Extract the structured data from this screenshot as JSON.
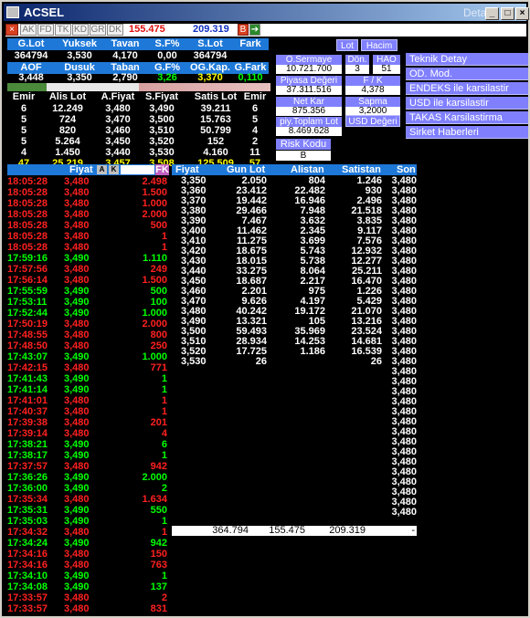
{
  "window": {
    "title": "ACSEL",
    "title_right": "Detay"
  },
  "toolbar": {
    "tabs": [
      "AK",
      "FD",
      "TK",
      "KD",
      "GR",
      "DK"
    ],
    "vol1": "155.475",
    "vol2": "209.319",
    "b_label": "B"
  },
  "summary": {
    "h1": [
      "G.Lot",
      "Yuksek",
      "Tavan",
      "S.F%",
      "S.Lot",
      "Fark"
    ],
    "r1": [
      "364794",
      "3,530",
      "4,170",
      "0,00",
      "364794",
      ""
    ],
    "h2": [
      "AOF",
      "Dusuk",
      "Taban",
      "G.F%",
      "OG.Kap.",
      "G.Fark"
    ],
    "r2": [
      "3,448",
      "3,350",
      "2,790",
      "3,26",
      "3,370",
      "0,110"
    ]
  },
  "depth": {
    "headers": [
      "Emir",
      "Alis Lot",
      "A.Fiyat",
      "S.Fiyat",
      "Satis Lot",
      "Emir"
    ],
    "rows": [
      [
        "6",
        "12.249",
        "3,480",
        "3,490",
        "39.211",
        "6"
      ],
      [
        "5",
        "724",
        "3,470",
        "3,500",
        "15.763",
        "5"
      ],
      [
        "5",
        "820",
        "3,460",
        "3,510",
        "50.799",
        "4"
      ],
      [
        "5",
        "5.264",
        "3,450",
        "3,520",
        "152",
        "2"
      ],
      [
        "4",
        "1.450",
        "3,440",
        "3,530",
        "4.160",
        "11"
      ]
    ],
    "total": [
      "47",
      "25.219",
      "3,457",
      "3,508",
      "125.509",
      "57"
    ]
  },
  "panel": {
    "lot_btn": "Lot",
    "hacim_btn": "Hacim",
    "o_sermaye_label": "O.Sermaye",
    "o_sermaye": "10.721.700",
    "don_label": "Dön.",
    "don": "3",
    "hao_label": "HAO",
    "hao": "51",
    "piyasa_label": "Piyasa Değeri",
    "piyasa": "37.311.516",
    "fk_label": "F / K",
    "fk": "4,378",
    "netkar_label": "Net Kar",
    "netkar": "875.356",
    "sapma_label": "Sapma",
    "sapma": "3,2000",
    "toplam_label": "piy.Toplam Lot",
    "toplam": "8.469.628",
    "usd_btn": "USD Değeri",
    "risk_label": "Risk Kodu",
    "risk": "B"
  },
  "side_menu": [
    "Teknik Detay",
    "OD. Mod.",
    "ENDEKS ile karsilastir",
    "USD ile karsilastir",
    "TAKAS Karsilastirma",
    "Sirket Haberleri"
  ],
  "trades": {
    "header": [
      "Fiyat",
      "A",
      "K",
      "FK"
    ],
    "rows": [
      [
        "18:05:28",
        "3,480",
        "2.498",
        "r"
      ],
      [
        "18:05:28",
        "3,480",
        "1.500",
        "r"
      ],
      [
        "18:05:28",
        "3,480",
        "1.000",
        "r"
      ],
      [
        "18:05:28",
        "3,480",
        "2.000",
        "r"
      ],
      [
        "18:05:28",
        "3,480",
        "500",
        "r"
      ],
      [
        "18:05:28",
        "3,480",
        "1",
        "r"
      ],
      [
        "18:05:28",
        "3,480",
        "1",
        "r"
      ],
      [
        "17:59:16",
        "3,490",
        "1.110",
        "g"
      ],
      [
        "17:57:56",
        "3,480",
        "249",
        "r"
      ],
      [
        "17:56:14",
        "3,480",
        "1.500",
        "r"
      ],
      [
        "17:55:59",
        "3,490",
        "500",
        "g"
      ],
      [
        "17:53:11",
        "3,490",
        "100",
        "g"
      ],
      [
        "17:52:44",
        "3,490",
        "1.000",
        "g"
      ],
      [
        "17:50:19",
        "3,480",
        "2.000",
        "r"
      ],
      [
        "17:48:55",
        "3,480",
        "800",
        "r"
      ],
      [
        "17:48:50",
        "3,480",
        "250",
        "r"
      ],
      [
        "17:43:07",
        "3,490",
        "1.000",
        "g"
      ],
      [
        "17:42:15",
        "3,480",
        "771",
        "r"
      ],
      [
        "17:41:43",
        "3,490",
        "1",
        "g"
      ],
      [
        "17:41:14",
        "3,490",
        "1",
        "g"
      ],
      [
        "17:41:01",
        "3,480",
        "1",
        "r"
      ],
      [
        "17:40:37",
        "3,480",
        "1",
        "r"
      ],
      [
        "17:39:38",
        "3,480",
        "201",
        "r"
      ],
      [
        "17:39:14",
        "3,480",
        "4",
        "r"
      ],
      [
        "17:38:21",
        "3,490",
        "6",
        "g"
      ],
      [
        "17:38:17",
        "3,490",
        "1",
        "g"
      ],
      [
        "17:37:57",
        "3,480",
        "942",
        "r"
      ],
      [
        "17:36:26",
        "3,490",
        "2.000",
        "g"
      ],
      [
        "17:36:00",
        "3,490",
        "2",
        "g"
      ],
      [
        "17:35:34",
        "3,480",
        "1.634",
        "r"
      ],
      [
        "17:35:31",
        "3,490",
        "550",
        "g"
      ],
      [
        "17:35:03",
        "3,490",
        "1",
        "g"
      ],
      [
        "17:34:32",
        "3,480",
        "1",
        "r"
      ],
      [
        "17:34:24",
        "3,490",
        "942",
        "g"
      ],
      [
        "17:34:16",
        "3,480",
        "150",
        "r"
      ],
      [
        "17:34:16",
        "3,480",
        "763",
        "r"
      ],
      [
        "17:34:10",
        "3,490",
        "1",
        "g"
      ],
      [
        "17:34:08",
        "3,490",
        "137",
        "g"
      ],
      [
        "17:33:57",
        "3,480",
        "2",
        "r"
      ],
      [
        "17:33:57",
        "3,480",
        "831",
        "r"
      ]
    ]
  },
  "levels": {
    "header": [
      "Fiyat",
      "Gun Lot",
      "Alistan",
      "Satistan",
      "Son"
    ],
    "rows": [
      [
        "3,350",
        "2.050",
        "804",
        "1.246",
        "3,480"
      ],
      [
        "3,360",
        "23.412",
        "22.482",
        "930",
        "3,480"
      ],
      [
        "3,370",
        "19.442",
        "16.946",
        "2.496",
        "3,480"
      ],
      [
        "3,380",
        "29.466",
        "7.948",
        "21.518",
        "3,480"
      ],
      [
        "3,390",
        "7.467",
        "3.632",
        "3.835",
        "3,480"
      ],
      [
        "3,400",
        "11.462",
        "2.345",
        "9.117",
        "3,480"
      ],
      [
        "3,410",
        "11.275",
        "3.699",
        "7.576",
        "3,480"
      ],
      [
        "3,420",
        "18.675",
        "5.743",
        "12.932",
        "3,480"
      ],
      [
        "3,430",
        "18.015",
        "5.738",
        "12.277",
        "3,480"
      ],
      [
        "3,440",
        "33.275",
        "8.064",
        "25.211",
        "3,480"
      ],
      [
        "3,450",
        "18.687",
        "2.217",
        "16.470",
        "3,480"
      ],
      [
        "3,460",
        "2.201",
        "975",
        "1.226",
        "3,480"
      ],
      [
        "3,470",
        "9.626",
        "4.197",
        "5.429",
        "3,480"
      ],
      [
        "3,480",
        "40.242",
        "19.172",
        "21.070",
        "3,480"
      ],
      [
        "3,490",
        "13.321",
        "105",
        "13.216",
        "3,480"
      ],
      [
        "3,500",
        "59.493",
        "35.969",
        "23.524",
        "3,480"
      ],
      [
        "3,510",
        "28.934",
        "14.253",
        "14.681",
        "3,480"
      ],
      [
        "3,520",
        "17.725",
        "1.186",
        "16.539",
        "3,480"
      ],
      [
        "3,530",
        "26",
        "",
        "26",
        "3,480"
      ]
    ],
    "son_only": 15,
    "son_value": "3,480",
    "totals": [
      "364.794",
      "155.475",
      "209.319",
      "-"
    ]
  }
}
